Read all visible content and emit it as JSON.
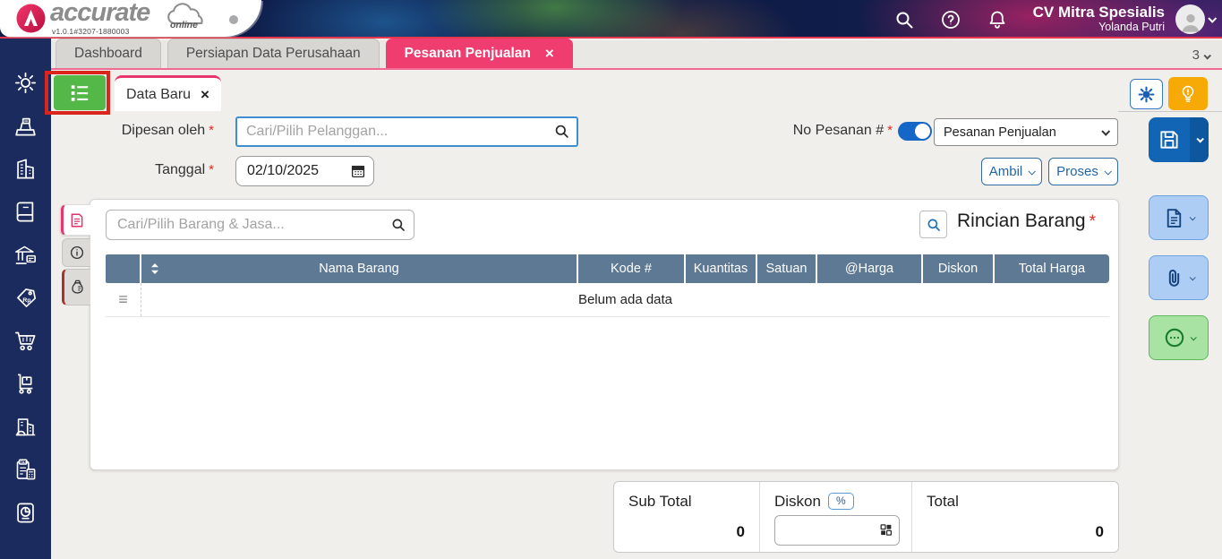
{
  "header": {
    "brand": "accurate",
    "brand_sub": "online",
    "version": "v1.0.1#3207-1880003",
    "company_name": "CV Mitra Spesialis",
    "user_name": "Yolanda Putri",
    "icons": [
      "search-icon",
      "help-icon",
      "bell-icon",
      "avatar",
      "chevron-down-icon"
    ]
  },
  "tabbar": {
    "tabs": [
      {
        "label": "Dashboard"
      },
      {
        "label": "Persiapan Data Perusahaan"
      },
      {
        "label": "Pesanan Penjualan"
      }
    ],
    "active_tab": "Pesanan Penjualan",
    "close_glyph": "×",
    "counter": "3"
  },
  "sidebar": {
    "icons": [
      "settings-gear",
      "cash-register",
      "company-buildings",
      "ledger-book",
      "bank",
      "price-tag-rp",
      "purchase-cart",
      "delivery-trolley",
      "fixed-asset",
      "tax-documents",
      "report-chart"
    ]
  },
  "doc": {
    "tab_label": "Data Baru",
    "close_glyph": "×",
    "required_marker": "*",
    "drag_handle_glyph": "≡"
  },
  "form": {
    "dipesan_label": "Dipesan oleh",
    "customer_placeholder": "Cari/Pilih Pelanggan...",
    "tanggal_label": "Tanggal",
    "tanggal_value": "02/10/2025",
    "no_pesanan_label": "No Pesanan #",
    "doc_type_selected": "Pesanan Penjualan",
    "ambil_label": "Ambil",
    "proses_label": "Proses"
  },
  "items": {
    "search_placeholder": "Cari/Pilih Barang & Jasa...",
    "section_title": "Rincian Barang",
    "columns": [
      "Nama Barang",
      "Kode #",
      "Kuantitas",
      "Satuan",
      "@Harga",
      "Diskon",
      "Total Harga"
    ],
    "empty_text": "Belum ada data"
  },
  "totals": {
    "sub_total_label": "Sub Total",
    "sub_total_value": "0",
    "diskon_label": "Diskon",
    "diskon_unit": "%",
    "diskon_value": "",
    "total_label": "Total",
    "total_value": "0"
  },
  "colors": {
    "accent_pink": "#ee3d6e",
    "navy_sidebar": "#1b2b5e",
    "primary_blue": "#1165b4",
    "table_header": "#5d7994",
    "green_button": "#53b848",
    "orange_button": "#f7a906",
    "annotation_red": "#da251d"
  }
}
